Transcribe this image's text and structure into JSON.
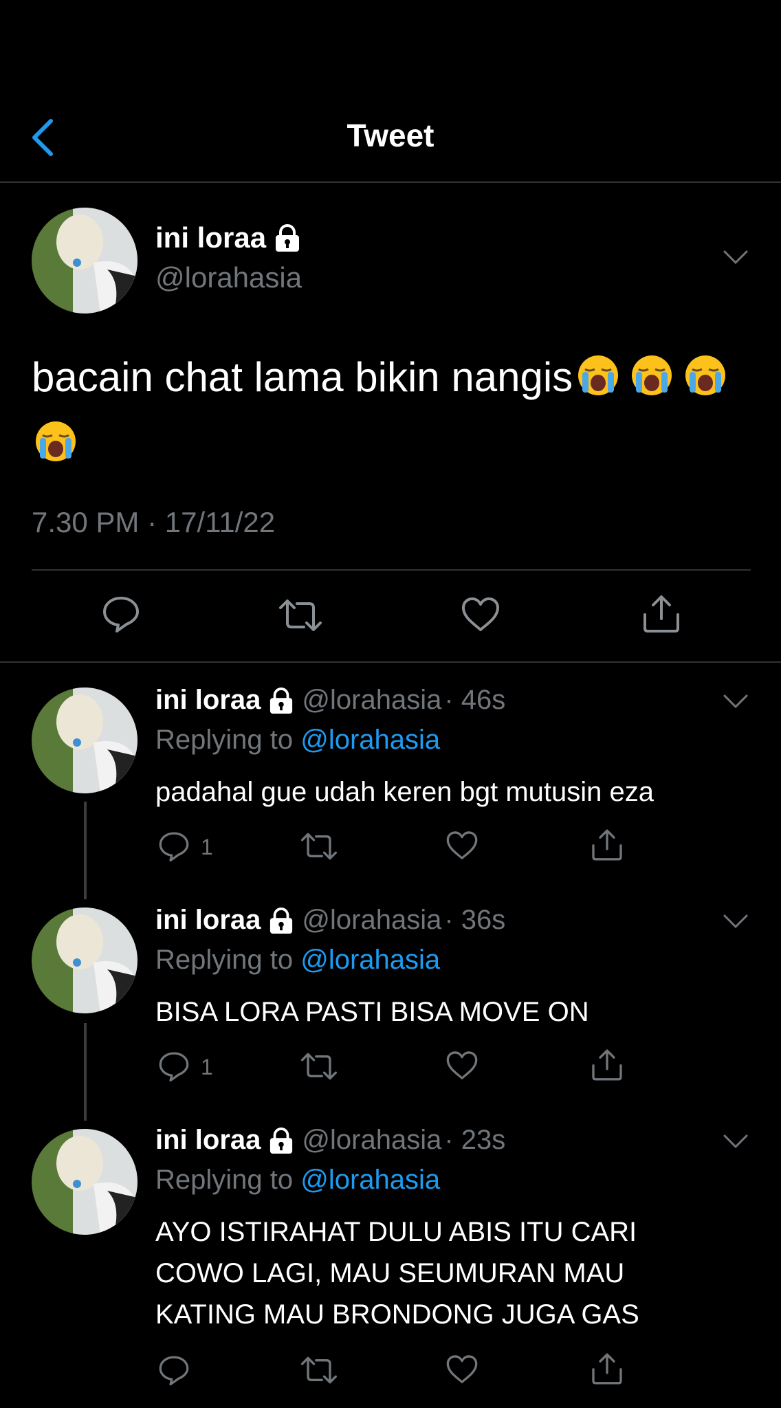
{
  "header": {
    "title": "Tweet"
  },
  "tweet": {
    "name": "ini loraa",
    "handle": "@lorahasia",
    "text": "bacain chat lama bikin nangis",
    "emoji": "loudly-crying-face",
    "emoji_count": 4,
    "timestamp": "7.30 PM · 17/11/22"
  },
  "replies": [
    {
      "name": "ini loraa",
      "handle": "@lorahasia",
      "time": "· 46s",
      "replying_label": "Replying to",
      "replying_mention": "@lorahasia",
      "lines": [
        "padahal gue udah keren bgt mutusin eza"
      ],
      "reply_count": "1"
    },
    {
      "name": "ini loraa",
      "handle": "@lorahasia",
      "time": "· 36s",
      "replying_label": "Replying to",
      "replying_mention": "@lorahasia",
      "lines": [
        "BISA LORA PASTI BISA MOVE ON"
      ],
      "reply_count": "1"
    },
    {
      "name": "ini loraa",
      "handle": "@lorahasia",
      "time": "· 23s",
      "replying_label": "Replying to",
      "replying_mention": "@lorahasia",
      "lines": [
        "AYO ISTIRAHAT DULU ABIS ITU CARI",
        "COWO LAGI, MAU SEUMURAN MAU",
        "KATING MAU BRONDONG JUGA GAS"
      ],
      "reply_count": ""
    }
  ],
  "icons": {
    "back": "chevron-left-icon",
    "lock": "lock-icon",
    "more": "chevron-down-icon",
    "reply": "reply-icon",
    "retweet": "retweet-icon",
    "like": "heart-icon",
    "share": "share-icon"
  },
  "colors": {
    "background": "#000000",
    "accent": "#1d9bf0",
    "muted": "#71767b",
    "text": "#e7e9ea"
  }
}
